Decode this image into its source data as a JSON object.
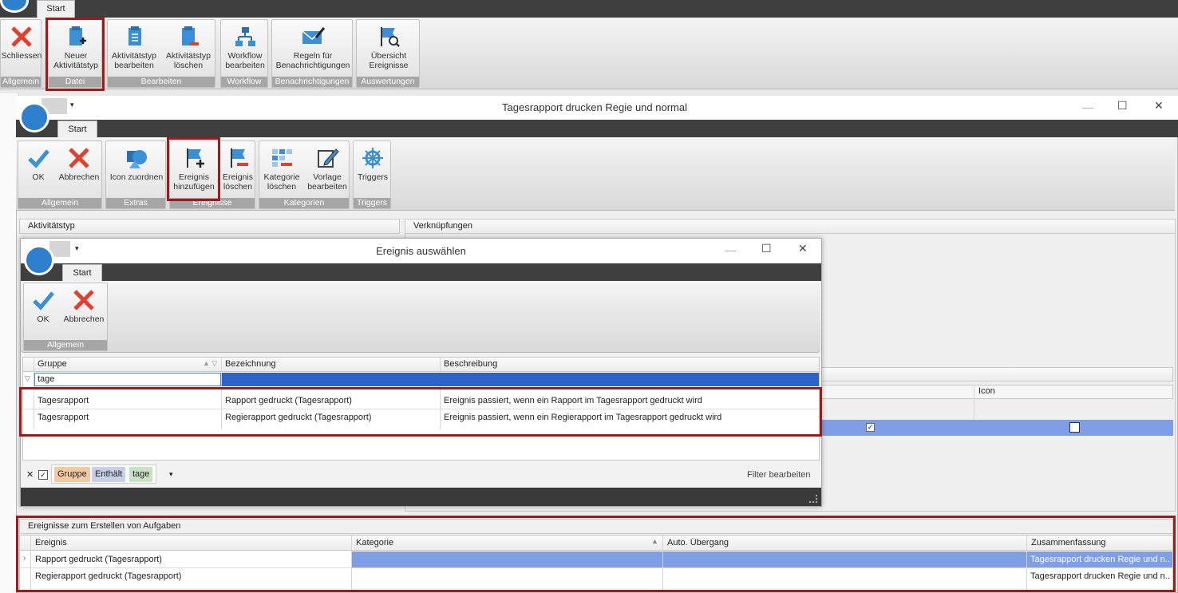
{
  "main": {
    "tab": "Start",
    "buttons": {
      "close": "Schliessen",
      "new_type_1": "Neuer",
      "new_type_2": "Aktivitätstyp",
      "edit_type_1": "Aktivitätstyp",
      "edit_type_2": "bearbeiten",
      "del_type_1": "Aktivitätstyp",
      "del_type_2": "löschen",
      "workflow_1": "Workflow",
      "workflow_2": "bearbeiten",
      "rules_1": "Regeln für",
      "rules_2": "Benachrichtigungen",
      "overview_1": "Übersicht",
      "overview_2": "Ereignisse"
    },
    "groups": {
      "allgemein": "Allgemein",
      "datei": "Datei",
      "bearbeiten": "Bearbeiten",
      "workflow": "Workflow",
      "benachrichtigungen": "Benachrichtigungen",
      "auswertungen": "Auswertungen"
    }
  },
  "window2": {
    "title": "Tagesrapport drucken Regie und normal",
    "tab": "Start",
    "buttons": {
      "ok": "OK",
      "cancel": "Abbrechen",
      "icon_assign": "Icon zuordnen",
      "add_event_1": "Ereignis",
      "add_event_2": "hinzufügen",
      "del_event_1": "Ereignis",
      "del_event_2": "löschen",
      "del_cat_1": "Kategorie",
      "del_cat_2": "löschen",
      "edit_tpl_1": "Vorlage",
      "edit_tpl_2": "bearbeiten",
      "triggers": "Triggers"
    },
    "groups": {
      "allgemein": "Allgemein",
      "extras": "Extras",
      "ereignisse": "Ereignisse",
      "kategorien": "Kategorien",
      "triggers": "Triggers"
    },
    "panel_left": "Aktivitätstyp",
    "panel_right": "Verknüpfungen",
    "right_grid_col": "Icon",
    "bottom": {
      "header": "Ereignisse zum Erstellen von Aufgaben",
      "columns": [
        "Ereignis",
        "Kategorie",
        "Auto. Übergang",
        "Zusammenfassung"
      ],
      "rows": [
        {
          "ereignis": "Rapport gedruckt (Tagesrapport)",
          "kategorie": "",
          "auto": "",
          "summary": "Tagesrapport drucken Regie und n..."
        },
        {
          "ereignis": "Regierapport gedruckt (Tagesrapport)",
          "kategorie": "",
          "auto": "",
          "summary": "Tagesrapport drucken Regie und n..."
        }
      ]
    }
  },
  "dialog": {
    "title": "Ereignis auswählen",
    "tab": "Start",
    "ok": "OK",
    "cancel": "Abbrechen",
    "group": "Allgemein",
    "columns": [
      "Gruppe",
      "Bezeichnung",
      "Beschreibung"
    ],
    "filter_value": "tage",
    "rows": [
      {
        "gruppe": "Tagesrapport",
        "bezeichnung": "Rapport gedruckt (Tagesrapport)",
        "beschreibung": "Ereignis passiert, wenn ein Rapport im Tagesrapport gedruckt wird"
      },
      {
        "gruppe": "Tagesrapport",
        "bezeichnung": "Regierapport gedruckt (Tagesrapport)",
        "beschreibung": "Ereignis passiert, wenn ein Regierapport im Tagesrapport gedruckt wird"
      }
    ],
    "filter_bar": {
      "field": "Gruppe",
      "op": "Enthält",
      "value": "tage",
      "edit": "Filter bearbeiten"
    }
  },
  "colors": {
    "accent": "#3a8fd6",
    "red": "#e0402f",
    "highlight": "#7f9ee6",
    "box": "#9b1c1c"
  }
}
